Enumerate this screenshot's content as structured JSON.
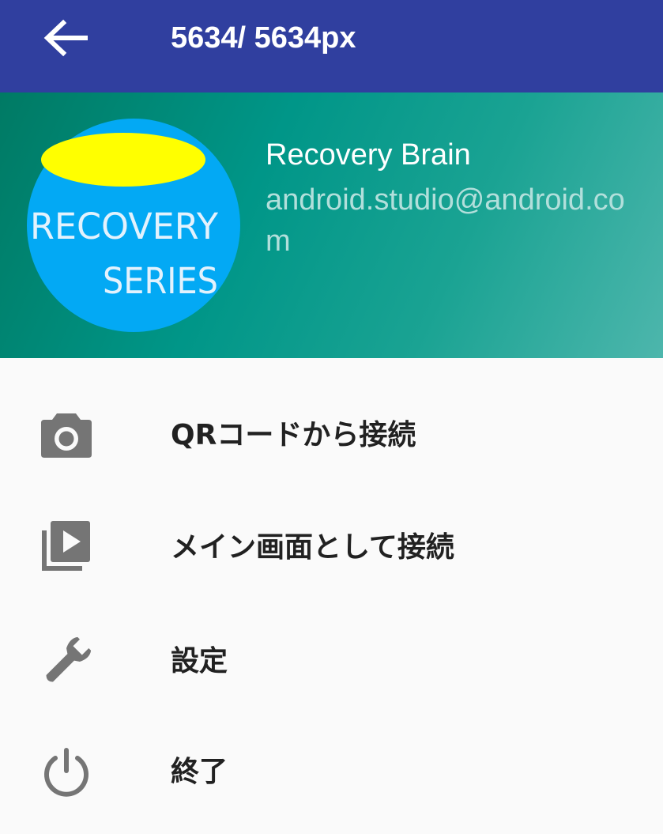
{
  "app_bar": {
    "back_icon": "arrow-back-icon",
    "title": "5634/ 5634px",
    "color": "#303f9f"
  },
  "drawer_header": {
    "logo": {
      "line1": "RECOVERY",
      "line2": "SERIES"
    },
    "user_name": "Recovery Brain",
    "user_email": "android.studio@android.com",
    "gradient_colors": [
      "#007a64",
      "#009688",
      "#4db6ac"
    ]
  },
  "menu": {
    "items": [
      {
        "icon": "camera-icon",
        "label": "QRコードから接続"
      },
      {
        "icon": "video-library-icon",
        "label": "メイン画面として接続"
      },
      {
        "icon": "wrench-icon",
        "label": "設定"
      },
      {
        "icon": "power-icon",
        "label": "終了"
      }
    ],
    "icon_color": "#757575",
    "text_color": "#212121"
  }
}
